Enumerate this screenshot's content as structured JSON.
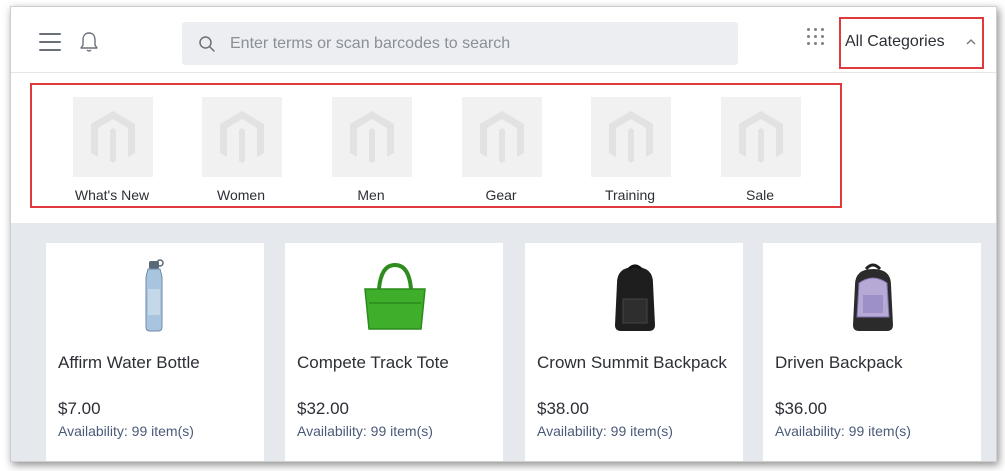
{
  "header": {
    "search_placeholder": "Enter terms or scan barcodes to search",
    "category_selector": "All Categories"
  },
  "categories": [
    {
      "label": "What's New"
    },
    {
      "label": "Women"
    },
    {
      "label": "Men"
    },
    {
      "label": "Gear"
    },
    {
      "label": "Training"
    },
    {
      "label": "Sale"
    }
  ],
  "products": [
    {
      "name": "Affirm Water Bottle",
      "price": "$7.00",
      "availability": "Availability: 99 item(s)"
    },
    {
      "name": "Compete Track Tote",
      "price": "$32.00",
      "availability": "Availability: 99 item(s)"
    },
    {
      "name": "Crown Summit Backpack",
      "price": "$38.00",
      "availability": "Availability: 99 item(s)"
    },
    {
      "name": "Driven Backpack",
      "price": "$36.00",
      "availability": "Availability: 99 item(s)"
    }
  ],
  "icons": {
    "menu": "hamburger-menu-icon",
    "notifications": "bell-icon",
    "search": "search-icon",
    "apps": "grid-apps-icon",
    "chevron": "chevron-up-icon",
    "category_placeholder": "magento-logo-icon"
  },
  "colors": {
    "highlight_border": "#e0393e",
    "content_background": "#e5e8ec",
    "search_background": "#eceef1"
  }
}
